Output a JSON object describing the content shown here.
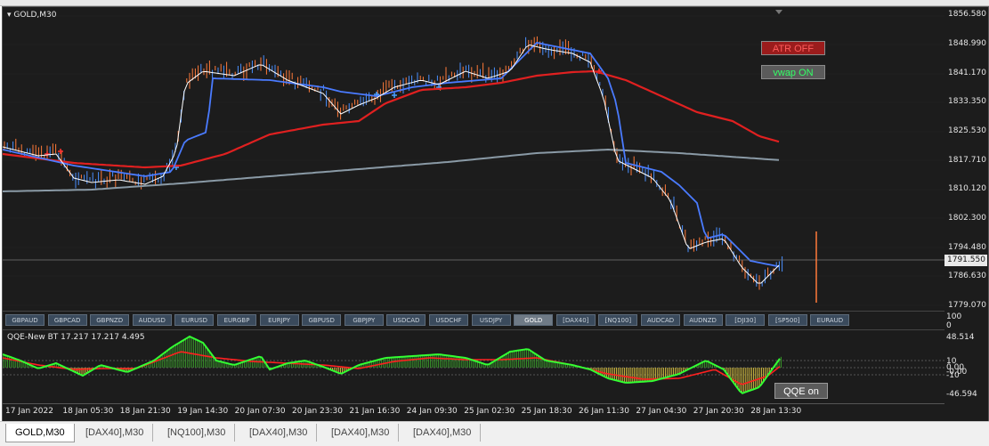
{
  "chart": {
    "title": "GOLD,M30",
    "price_labels": [
      "1856.580",
      "1848.990",
      "1841.170",
      "1833.350",
      "1825.530",
      "1817.710",
      "1810.120",
      "1802.300",
      "1794.480",
      "1786.630",
      "1779.070"
    ],
    "current_price": "1791.550",
    "atr_button": "ATR OFF",
    "vwap_button": "vwap ON",
    "colors": {
      "candle_up": "#4a90ff",
      "candle_down": "#ff7a3a",
      "ma_fast": "#ffffff",
      "ma_blue": "#4a7bff",
      "ma_red": "#e02020",
      "ma_gray": "#8a9aa6"
    }
  },
  "symbol_bar": {
    "items": [
      "GBPAUD",
      "GBPCAD",
      "GBPNZD",
      "AUDUSD",
      "EURUSD",
      "EURGBP",
      "EURJPY",
      "GBPUSD",
      "GBPJPY",
      "USDCAD",
      "USDCHF",
      "USDJPY",
      "GOLD",
      "[DAX40]",
      "[NQ100]",
      "AUDCAD",
      "AUDNZD",
      "[DJI30]",
      "[SP500]",
      "EURAUD"
    ],
    "active": "GOLD"
  },
  "qqe": {
    "title": "QQE-New BT 17.217 17.217 4.495",
    "scale_labels": [
      "100",
      "0",
      "48.514",
      "10",
      "0.00",
      "-0.00",
      "-10",
      "-46.594"
    ],
    "button": "QQE on",
    "colors": {
      "line_green": "#33ff33",
      "line_red": "#ff2020",
      "hist": "#d8c040"
    }
  },
  "time_axis": [
    "17 Jan 2022",
    "18 Jan 05:30",
    "18 Jan 21:30",
    "19 Jan 14:30",
    "20 Jan 07:30",
    "20 Jan 23:30",
    "21 Jan 16:30",
    "24 Jan 09:30",
    "25 Jan 02:30",
    "25 Jan 18:30",
    "26 Jan 11:30",
    "27 Jan 04:30",
    "27 Jan 20:30",
    "28 Jan 13:30"
  ],
  "tabs": {
    "items": [
      "GOLD,M30",
      "[DAX40],M30",
      "[NQ100],M30",
      "[DAX40],M30",
      "[DAX40],M30",
      "[DAX40],M30"
    ],
    "active": 0
  }
}
